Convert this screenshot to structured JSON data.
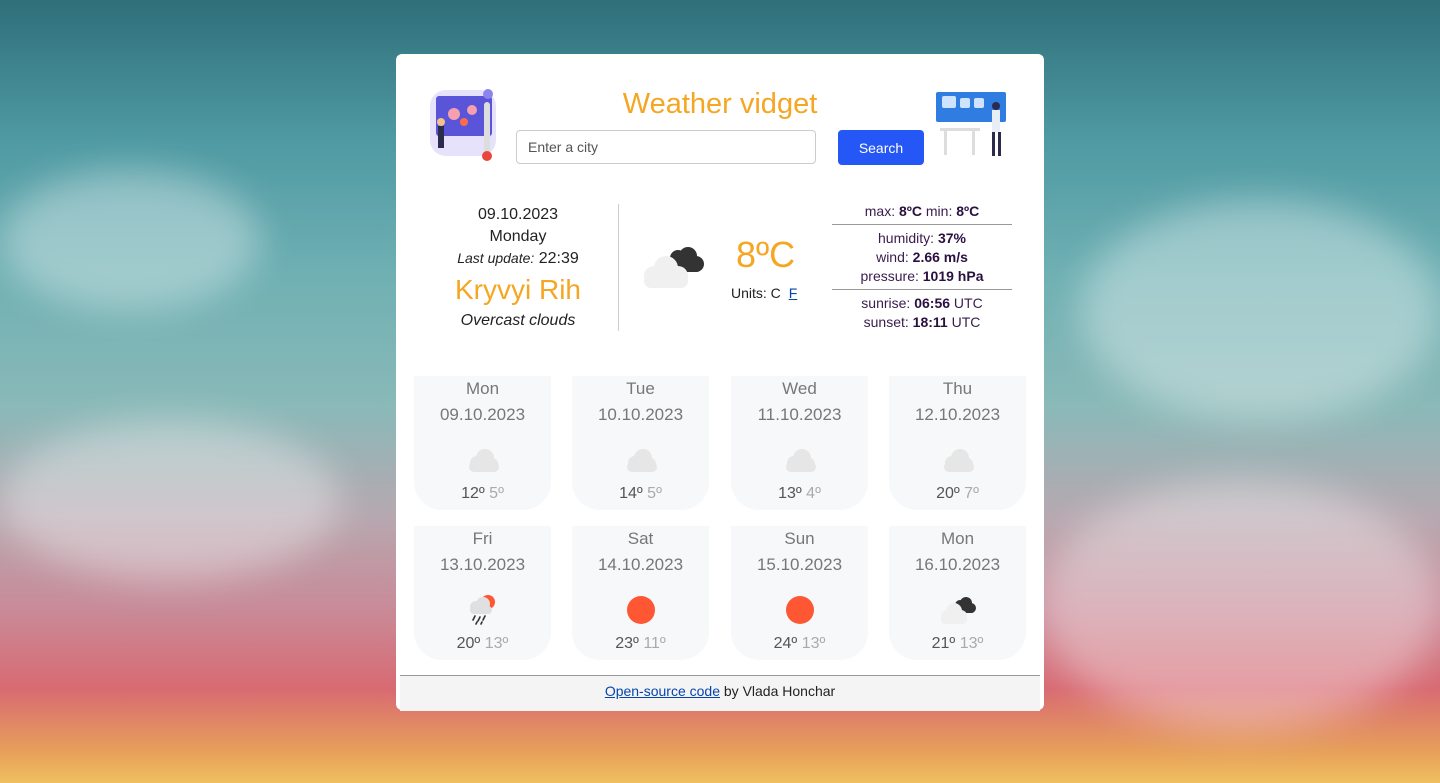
{
  "colors": {
    "accent": "#f5a623",
    "button": "#2457f5",
    "sun": "#ff5733"
  },
  "header": {
    "title": "Weather vidget",
    "search_placeholder": "Enter a city",
    "search_button": "Search"
  },
  "current": {
    "date": "09.10.2023",
    "weekday": "Monday",
    "last_update_label": "Last update:",
    "last_update_time": "22:39",
    "city": "Kryvyi Rih",
    "description": "Overcast clouds",
    "icon": "overcast-clouds-icon",
    "temperature": "8ºC",
    "units_label": "Units: C",
    "units_f": "F"
  },
  "details": {
    "max_label": "max:",
    "max_value": "8ºC",
    "min_label": "min:",
    "min_value": "8ºC",
    "humidity_label": "humidity:",
    "humidity_value": "37%",
    "wind_label": "wind:",
    "wind_value": "2.66 m/s",
    "pressure_label": "pressure:",
    "pressure_value": "1019 hPa",
    "sunrise_label": "sunrise:",
    "sunrise_value": "06:56",
    "sunrise_tz": "UTC",
    "sunset_label": "sunset:",
    "sunset_value": "18:11",
    "sunset_tz": "UTC"
  },
  "forecast": [
    {
      "day": "Mon",
      "date": "09.10.2023",
      "icon": "cloud-icon",
      "max": "12º",
      "min": "5º"
    },
    {
      "day": "Tue",
      "date": "10.10.2023",
      "icon": "cloud-icon",
      "max": "14º",
      "min": "5º"
    },
    {
      "day": "Wed",
      "date": "11.10.2023",
      "icon": "cloud-icon",
      "max": "13º",
      "min": "4º"
    },
    {
      "day": "Thu",
      "date": "12.10.2023",
      "icon": "cloud-icon",
      "max": "20º",
      "min": "7º"
    },
    {
      "day": "Fri",
      "date": "13.10.2023",
      "icon": "rain-sun-icon",
      "max": "20º",
      "min": "13º"
    },
    {
      "day": "Sat",
      "date": "14.10.2023",
      "icon": "sun-icon",
      "max": "23º",
      "min": "11º"
    },
    {
      "day": "Sun",
      "date": "15.10.2023",
      "icon": "sun-icon",
      "max": "24º",
      "min": "13º"
    },
    {
      "day": "Mon",
      "date": "16.10.2023",
      "icon": "overcast-clouds-icon",
      "max": "21º",
      "min": "13º"
    }
  ],
  "footer": {
    "link_text": "Open-source code",
    "suffix": " by Vlada Honchar"
  }
}
